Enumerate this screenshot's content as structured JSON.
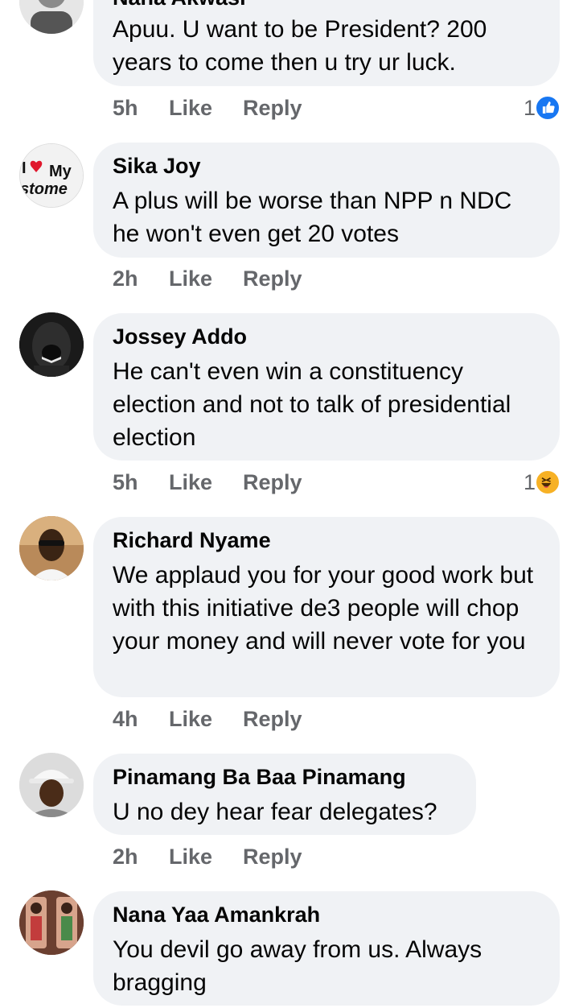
{
  "comments": [
    {
      "author": "Nana Akwasi",
      "text": "Apuu. U want to be President? 200 years to come then u try ur luck.",
      "time": "5h",
      "like": "Like",
      "reply": "Reply",
      "reaction_count": "1",
      "reaction": "like-icon"
    },
    {
      "author": "Sika Joy",
      "text": "A plus will be worse than NPP n NDC he won't even get 20 votes",
      "time": "2h",
      "like": "Like",
      "reply": "Reply",
      "avatar_text_top": "I",
      "avatar_text_mid": "My",
      "avatar_text_bottom": "stome"
    },
    {
      "author": "Jossey Addo",
      "text": "He can't even win a constituency election and not to talk of presidential election",
      "time": "5h",
      "like": "Like",
      "reply": "Reply",
      "reaction_count": "1",
      "reaction": "haha-icon"
    },
    {
      "author": "Richard Nyame",
      "text": "We applaud you for your good work but with this initiative de3 people will chop your money and will never vote for you",
      "time": "4h",
      "like": "Like",
      "reply": "Reply"
    },
    {
      "author": "Pinamang Ba Baa Pinamang",
      "text": "U no dey hear fear delegates?",
      "time": "2h",
      "like": "Like",
      "reply": "Reply"
    },
    {
      "author": "Nana Yaa Amankrah",
      "text": "You devil go away from us. Always bragging",
      "time": "",
      "like": "",
      "reply": ""
    }
  ],
  "colors": {
    "bubble": "#f0f2f5",
    "meta": "#65676b",
    "like_blue": "#1877f2",
    "haha_yellow": "#f7b125"
  }
}
